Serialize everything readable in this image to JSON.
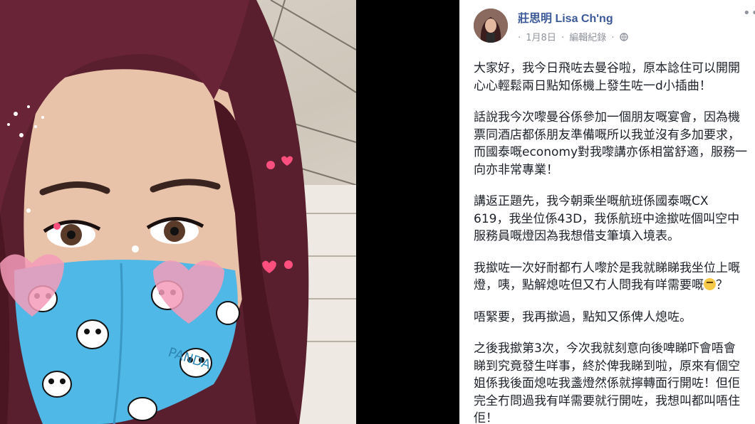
{
  "post": {
    "author": "莊思明 Lisa Ch'ng",
    "meta": {
      "separator_lead": "·",
      "date": "1月8日",
      "separator1": "·",
      "edit_history": "編輯紀錄",
      "separator2": "·",
      "privacy_icon": "globe-icon"
    },
    "more_icon": "more-options-icon",
    "paragraphs": [
      [
        "大家好，我今日飛咗去曼谷啦，原本諗住可以開開",
        "心心輕鬆兩日點知係機上發生咗一d小插曲！"
      ],
      [
        "話說我今次嚟曼谷係參加一個朋友嘅宴會，因為機",
        "票同酒店都係朋友準備嘅所以我並沒有多加要求，",
        "而國泰嘅economy對我嚟講亦係相當舒適，服務一",
        "向亦非常專業！"
      ],
      [
        "講返正題先，我今朝乘坐嘅航班係國泰嘅CX",
        "619，我坐位係43D，我係航班中途撳咗個叫空中",
        "服務員嘅燈因為我想借支筆填入境表。"
      ],
      [
        "我撳咗一次好耐都冇人嚟於是我就睇睇我坐位上嘅",
        "燈，咦，點解熄咗但又冇人問我有咩需要嘅",
        "？"
      ],
      [
        "唔緊要，我再撳過，點知又係俾人熄咗。"
      ],
      [
        "之後我撳第3次，今次我就刻意向後啤睇吓會唔會",
        "睇到究竟發生咩事，終於俾我睇到啦，原來有個空",
        "姐係我後面熄咗我盞燈然係就擰轉面行開咗！但佢",
        "完全冇問過我有咩需要就行開咗，我想叫都叫唔住",
        "佢！"
      ]
    ]
  },
  "photo": {
    "mask_text": "PANDA"
  }
}
